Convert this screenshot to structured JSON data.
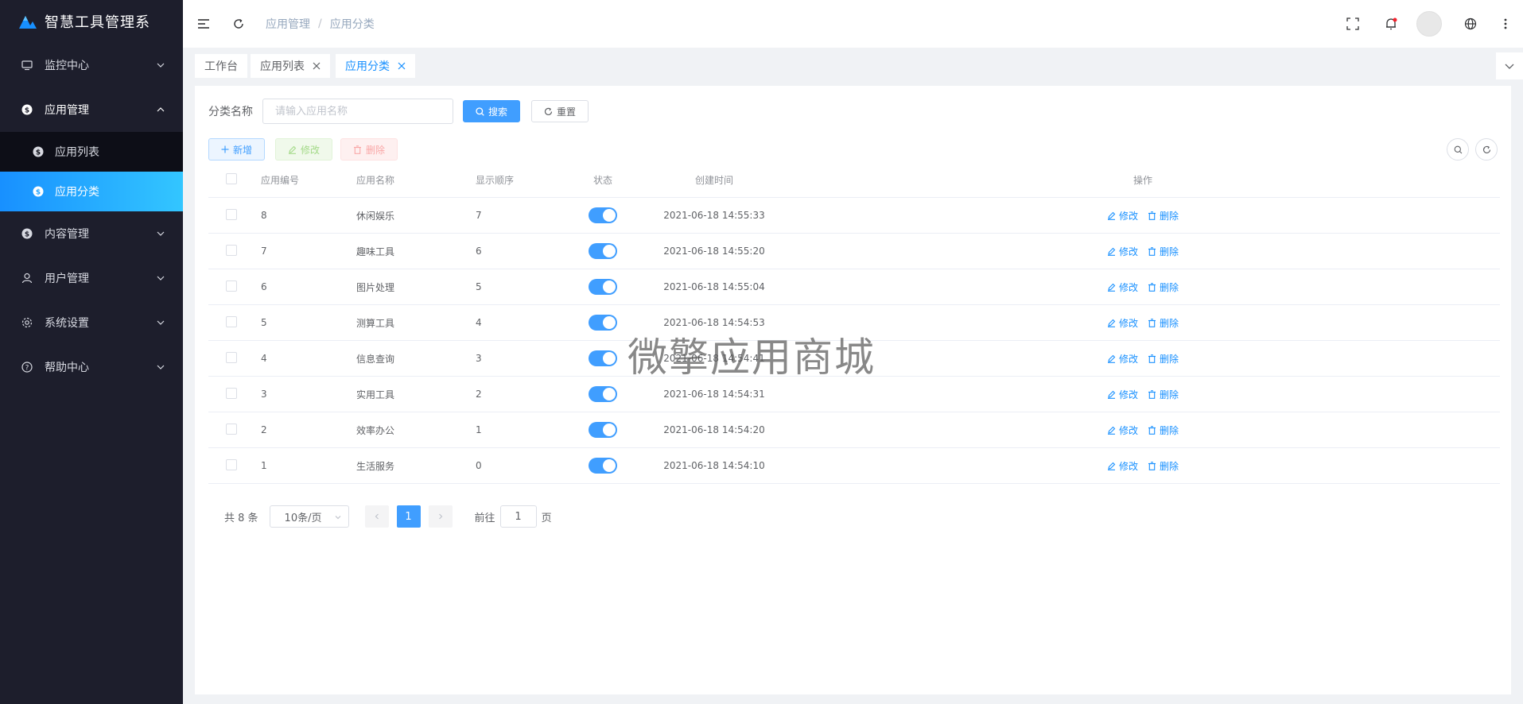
{
  "app": {
    "title": "智慧工具管理系"
  },
  "colors": {
    "accent": "#409eff",
    "sidebar_bg": "#1d1e2c",
    "active_gradient_start": "#1890ff",
    "active_gradient_end": "#33c6ff"
  },
  "sidebar": {
    "menus": [
      {
        "label": "监控中心",
        "icon": "monitor-icon",
        "open": false
      },
      {
        "label": "应用管理",
        "icon": "dollar-circle-icon",
        "open": true,
        "children": [
          {
            "label": "应用列表",
            "icon": "dollar-circle-icon",
            "active": false
          },
          {
            "label": "应用分类",
            "icon": "dollar-circle-icon",
            "active": true
          }
        ]
      },
      {
        "label": "内容管理",
        "icon": "dollar-circle-icon",
        "open": false
      },
      {
        "label": "用户管理",
        "icon": "user-icon",
        "open": false
      },
      {
        "label": "系统设置",
        "icon": "gear-icon",
        "open": false
      },
      {
        "label": "帮助中心",
        "icon": "question-circle-icon",
        "open": false
      }
    ]
  },
  "header": {
    "breadcrumb": [
      "应用管理",
      "应用分类"
    ],
    "separator": "/",
    "icons": [
      "hamburger-icon",
      "refresh-icon",
      "fullscreen-icon",
      "bell-icon",
      "avatar",
      "globe-icon",
      "more-vertical-icon"
    ]
  },
  "tags": [
    {
      "label": "工作台",
      "closable": false,
      "active": false
    },
    {
      "label": "应用列表",
      "closable": true,
      "active": false
    },
    {
      "label": "应用分类",
      "closable": true,
      "active": true
    }
  ],
  "search": {
    "label": "分类名称",
    "placeholder": "请输入应用名称",
    "value": "",
    "search_button": "搜索",
    "reset_button": "重置"
  },
  "toolbar": {
    "add": "新增",
    "edit": "修改",
    "delete": "删除"
  },
  "table": {
    "columns": [
      "应用编号",
      "应用名称",
      "显示顺序",
      "状态",
      "创建时间",
      "操作"
    ],
    "rows": [
      {
        "id": "8",
        "name": "休闲娱乐",
        "order": "7",
        "status": true,
        "created": "2021-06-18 14:55:33"
      },
      {
        "id": "7",
        "name": "趣味工具",
        "order": "6",
        "status": true,
        "created": "2021-06-18 14:55:20"
      },
      {
        "id": "6",
        "name": "图片处理",
        "order": "5",
        "status": true,
        "created": "2021-06-18 14:55:04"
      },
      {
        "id": "5",
        "name": "测算工具",
        "order": "4",
        "status": true,
        "created": "2021-06-18 14:54:53"
      },
      {
        "id": "4",
        "name": "信息查询",
        "order": "3",
        "status": true,
        "created": "2021-06-18 14:54:41"
      },
      {
        "id": "3",
        "name": "实用工具",
        "order": "2",
        "status": true,
        "created": "2021-06-18 14:54:31"
      },
      {
        "id": "2",
        "name": "效率办公",
        "order": "1",
        "status": true,
        "created": "2021-06-18 14:54:20"
      },
      {
        "id": "1",
        "name": "生活服务",
        "order": "0",
        "status": true,
        "created": "2021-06-18 14:54:10"
      }
    ],
    "op_edit": "修改",
    "op_delete": "删除"
  },
  "pagination": {
    "total_text": "共 8 条",
    "page_size": "10条/页",
    "current_page": "1",
    "goto_label": "前往",
    "goto_value": "1",
    "page_suffix": "页"
  },
  "watermark": "微擎应用商城"
}
